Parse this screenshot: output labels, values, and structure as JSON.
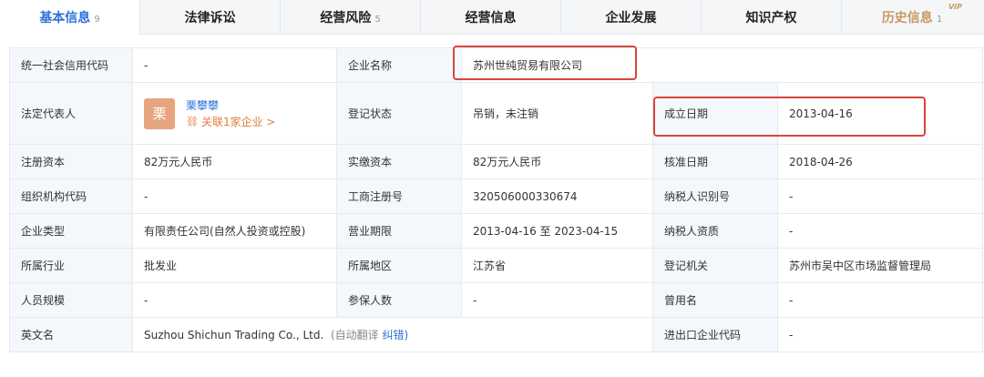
{
  "tabs": [
    {
      "label": "基本信息",
      "count": "9"
    },
    {
      "label": "法律诉讼",
      "count": ""
    },
    {
      "label": "经营风险",
      "count": "5"
    },
    {
      "label": "经营信息",
      "count": ""
    },
    {
      "label": "企业发展",
      "count": ""
    },
    {
      "label": "知识产权",
      "count": ""
    },
    {
      "label": "历史信息",
      "count": "1",
      "badge": "VIP"
    }
  ],
  "info": {
    "credit_code_label": "统一社会信用代码",
    "credit_code": "-",
    "company_name_label": "企业名称",
    "company_name": "苏州世纯贸易有限公司",
    "legal_rep_label": "法定代表人",
    "legal_rep_avatar": "栗",
    "legal_rep_name": "栗攀攀",
    "legal_rep_link": "关联1家企业 >",
    "reg_status_label": "登记状态",
    "reg_status": "吊销，未注销",
    "est_date_label": "成立日期",
    "est_date": "2013-04-16",
    "reg_capital_label": "注册资本",
    "reg_capital": "82万元人民币",
    "paid_capital_label": "实缴资本",
    "paid_capital": "82万元人民币",
    "approve_date_label": "核准日期",
    "approve_date": "2018-04-26",
    "org_code_label": "组织机构代码",
    "org_code": "-",
    "biz_reg_no_label": "工商注册号",
    "biz_reg_no": "320506000330674",
    "taxpayer_id_label": "纳税人识别号",
    "taxpayer_id": "-",
    "company_type_label": "企业类型",
    "company_type": "有限责任公司(自然人投资或控股)",
    "biz_term_label": "营业期限",
    "biz_term": "2013-04-16 至 2023-04-15",
    "taxpayer_qual_label": "纳税人资质",
    "taxpayer_qual": "-",
    "industry_label": "所属行业",
    "industry": "批发业",
    "region_label": "所属地区",
    "region": "江苏省",
    "authority_label": "登记机关",
    "authority": "苏州市吴中区市场监督管理局",
    "staff_size_label": "人员规模",
    "staff_size": "-",
    "insured_label": "参保人数",
    "insured": "-",
    "former_name_label": "曾用名",
    "former_name": "-",
    "english_name_label": "英文名",
    "english_name": "Suzhou Shichun Trading Co., Ltd.",
    "auto_translate": "(自动翻译",
    "correct_link": "纠错)",
    "import_export_label": "进出口企业代码",
    "import_export": "-"
  }
}
